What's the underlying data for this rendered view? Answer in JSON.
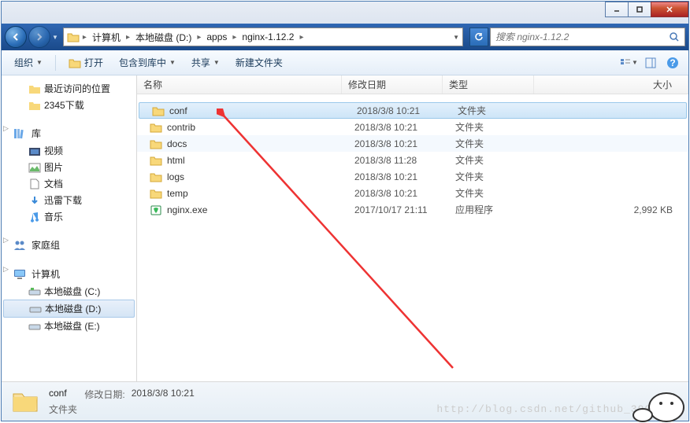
{
  "breadcrumbs": [
    "计算机",
    "本地磁盘 (D:)",
    "apps",
    "nginx-1.12.2"
  ],
  "search": {
    "placeholder": "搜索 nginx-1.12.2"
  },
  "toolbar": {
    "organize": "组织",
    "open": "打开",
    "include": "包含到库中",
    "share": "共享",
    "newfolder": "新建文件夹"
  },
  "sidebar": {
    "recent": "最近访问的位置",
    "download2345": "2345下载",
    "library": "库",
    "videos": "视频",
    "pictures": "图片",
    "documents": "文档",
    "xunlei": "迅雷下载",
    "music": "音乐",
    "homegroup": "家庭组",
    "computer": "计算机",
    "diskC": "本地磁盘 (C:)",
    "diskD": "本地磁盘 (D:)",
    "diskE": "本地磁盘 (E:)"
  },
  "columns": {
    "name": "名称",
    "date": "修改日期",
    "type": "类型",
    "size": "大小"
  },
  "files": [
    {
      "name": "conf",
      "date": "2018/3/8 10:21",
      "type": "文件夹",
      "size": "",
      "icon": "folder",
      "sel": true
    },
    {
      "name": "contrib",
      "date": "2018/3/8 10:21",
      "type": "文件夹",
      "size": "",
      "icon": "folder"
    },
    {
      "name": "docs",
      "date": "2018/3/8 10:21",
      "type": "文件夹",
      "size": "",
      "icon": "folder",
      "alt": true
    },
    {
      "name": "html",
      "date": "2018/3/8 11:28",
      "type": "文件夹",
      "size": "",
      "icon": "folder"
    },
    {
      "name": "logs",
      "date": "2018/3/8 10:21",
      "type": "文件夹",
      "size": "",
      "icon": "folder"
    },
    {
      "name": "temp",
      "date": "2018/3/8 10:21",
      "type": "文件夹",
      "size": "",
      "icon": "folder"
    },
    {
      "name": "nginx.exe",
      "date": "2017/10/17 21:11",
      "type": "应用程序",
      "size": "2,992 KB",
      "icon": "exe"
    }
  ],
  "status": {
    "name": "conf",
    "date_label": "修改日期:",
    "date": "2018/3/8 10:21",
    "type": "文件夹"
  },
  "watermark": "http://blog.csdn.net/github_3906"
}
